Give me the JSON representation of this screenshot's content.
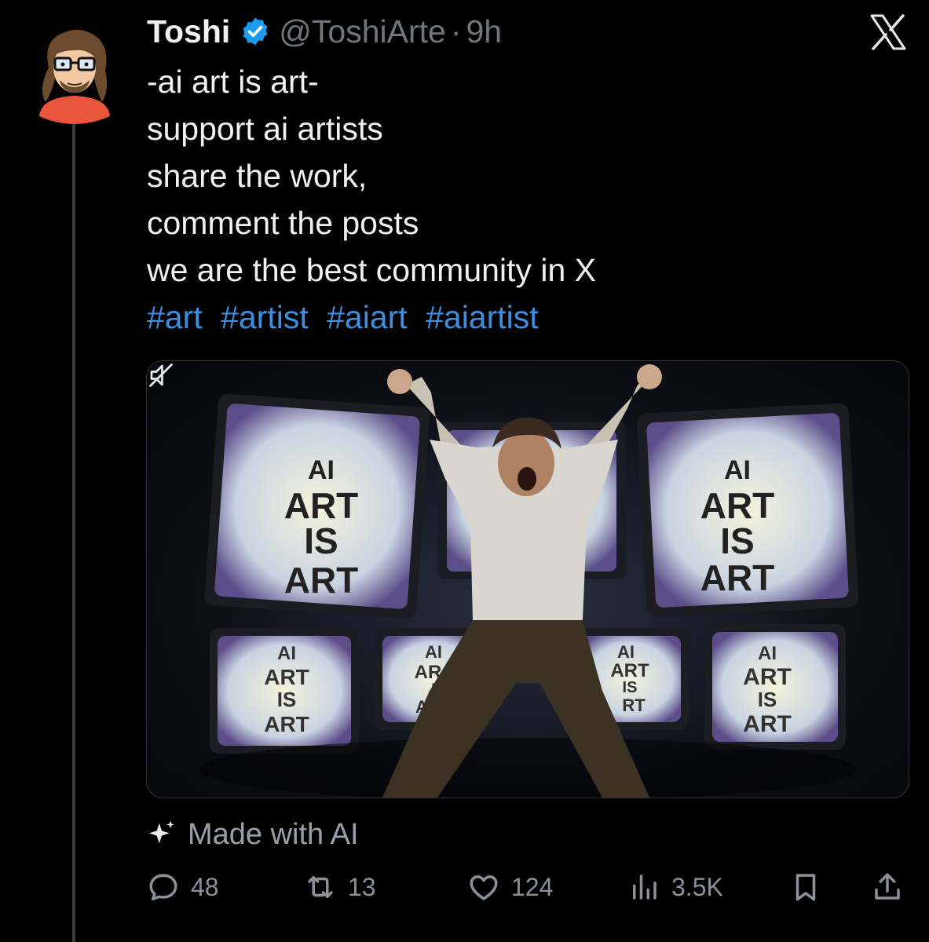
{
  "author": {
    "name": "Toshi",
    "handle": "@ToshiArte",
    "separator": "·",
    "time": "9h",
    "verified": true
  },
  "tweet": {
    "lines": [
      "-ai art is art-",
      "support ai artists",
      "share the work,",
      "comment the posts",
      "we are the best community in X"
    ],
    "hashtags": [
      "#art",
      "#artist",
      "#aiart",
      "#aiartist"
    ]
  },
  "media": {
    "screens": {
      "top_left": [
        "AI",
        "ART",
        "IS",
        "ART"
      ],
      "top_right": [
        "AI",
        "ART",
        "IS",
        "ART"
      ],
      "bottom_1": [
        "AI",
        "ART",
        "IS",
        "ART"
      ],
      "bottom_2": [
        "AI",
        "AR",
        "I",
        "A"
      ],
      "bottom_3": [
        "AI",
        "ART",
        "IS",
        "RT"
      ],
      "bottom_4": [
        "AI",
        "ART",
        "IS",
        "ART"
      ]
    },
    "muted": true
  },
  "ai_label": "Made with AI",
  "actions": {
    "replies": "48",
    "reposts": "13",
    "likes": "124",
    "views": "3.5K"
  },
  "colors": {
    "background": "#000000",
    "link": "#3d8fe0",
    "verified": "#1d9bf0",
    "muted_text": "#71767b"
  },
  "icons": [
    "x-logo-icon",
    "verified-badge-icon",
    "sparkle-icon",
    "reply-icon",
    "repost-icon",
    "like-icon",
    "views-icon",
    "bookmark-icon",
    "share-icon",
    "mute-icon"
  ]
}
